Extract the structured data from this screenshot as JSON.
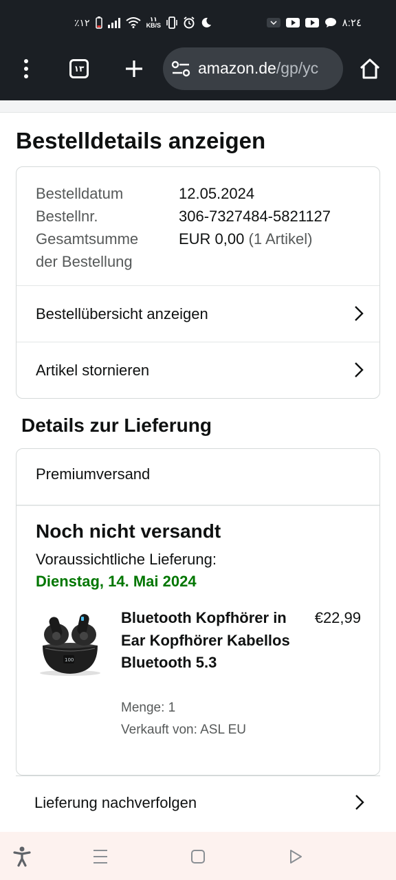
{
  "status_bar": {
    "battery": "٪۱۲",
    "net_speed_value": "۱۱",
    "net_speed_unit": "KB/S",
    "time": "٨:٢٤",
    "icons": [
      "battery-icon",
      "signal-icon",
      "wifi-icon",
      "vibrate-icon",
      "alarm-icon",
      "moon-icon",
      "chevron-icon",
      "youtube-icon",
      "youtube-icon",
      "chat-icon"
    ]
  },
  "browser": {
    "tab_count": "۱۳",
    "url_host": "amazon.de",
    "url_path": "/gp/yc",
    "icons": [
      "more-vert-icon",
      "tabs-icon",
      "plus-icon",
      "site-settings-icon",
      "home-icon"
    ]
  },
  "page": {
    "title": "Bestelldetails anzeigen"
  },
  "order_info": {
    "rows": [
      {
        "label": "Bestelldatum",
        "value": "12.05.2024"
      },
      {
        "label": "Bestellnr.",
        "value": "306-7327484-5821127"
      }
    ],
    "total_label": "Gesamtsumme der Bestellung",
    "total_label_line1": "Gesamtsumme",
    "total_label_line2": "der Bestellung",
    "total_value": "EUR 0,00",
    "total_items": "(1 Artikel)"
  },
  "order_links": {
    "overview": "Bestellübersicht anzeigen",
    "cancel": "Artikel stornieren"
  },
  "delivery": {
    "section_title": "Details zur Lieferung",
    "shipping_method": "Premiumversand",
    "status": "Noch nicht versandt",
    "expected_label": "Voraussichtliche Lieferung:",
    "expected_date": "Dienstag, 14. Mai 2024",
    "colors": {
      "date": "#007600"
    }
  },
  "product": {
    "name": "Bluetooth Kopfhörer in Ear Kopfhörer Kabellos Bluetooth 5.3",
    "price": "€22,99",
    "quantity": "Menge: 1",
    "seller": "Verkauft von: ASL EU",
    "image": "earbuds-product-image"
  },
  "tracking": {
    "label": "Lieferung nachverfolgen"
  },
  "nav_bar": {
    "icons": [
      "accessibility-icon",
      "recents-icon",
      "home-square-icon",
      "back-triangle-icon"
    ]
  }
}
